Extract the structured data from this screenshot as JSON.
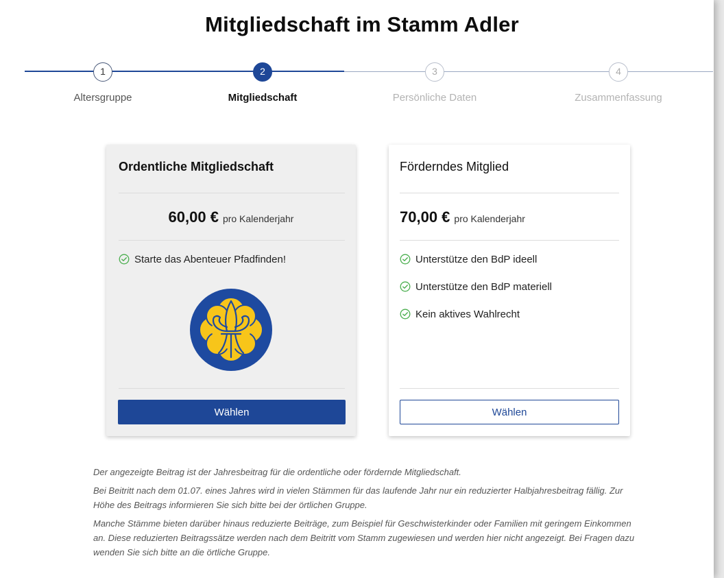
{
  "page": {
    "title": "Mitgliedschaft im Stamm Adler"
  },
  "stepper": {
    "steps": [
      {
        "number": "1",
        "label": "Altersgruppe",
        "state": "done"
      },
      {
        "number": "2",
        "label": "Mitgliedschaft",
        "state": "active"
      },
      {
        "number": "3",
        "label": "Persönliche Daten",
        "state": "pending"
      },
      {
        "number": "4",
        "label": "Zusammenfassung",
        "state": "pending"
      }
    ]
  },
  "cards": {
    "primary": {
      "title": "Ordentliche Mitgliedschaft",
      "price": "60,00 €",
      "period": "pro Kalenderjahr",
      "features": [
        "Starte das Abenteuer Pfadfinden!"
      ],
      "emblem_icon": "bdp-lily-emblem-icon",
      "button_label": "Wählen"
    },
    "secondary": {
      "title": "Förderndes Mitglied",
      "price": "70,00 €",
      "period": "pro Kalenderjahr",
      "features": [
        "Unterstütze den BdP ideell",
        "Unterstütze den BdP materiell",
        "Kein aktives Wahlrecht"
      ],
      "button_label": "Wählen"
    }
  },
  "notes": [
    "Der angezeigte Beitrag ist der Jahresbeitrag für die ordentliche oder fördernde Mitgliedschaft.",
    "Bei Beitritt nach dem 01.07. eines Jahres wird in vielen Stämmen für das laufende Jahr nur ein reduzierter Halbjahresbeitrag fällig. Zur Höhe des Beitrags informieren Sie sich bitte bei der örtlichen Gruppe.",
    "Manche Stämme bieten darüber hinaus reduzierte Beiträge, zum Beispiel für Geschwisterkinder oder Familien mit geringem Einkommen an. Diese reduzierten Beitragssätze werden nach dem Beitritt vom Stamm zugewiesen und werden hier nicht angezeigt. Bei Fragen dazu wenden Sie sich bitte an die örtliche Gruppe."
  ],
  "colors": {
    "accent": "#1e4797",
    "check": "#4caf50",
    "emblem_blue": "#1e4aa0",
    "emblem_yellow": "#f7c51a"
  }
}
